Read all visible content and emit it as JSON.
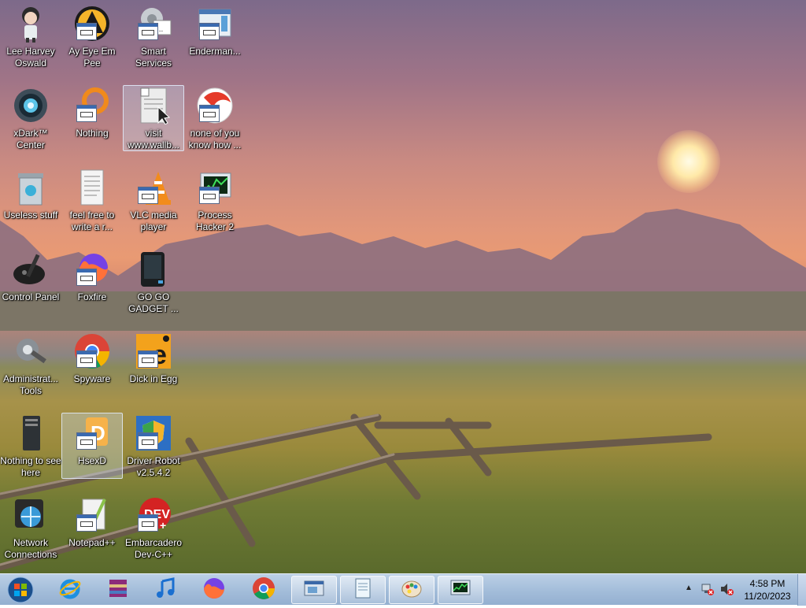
{
  "desktop_icons": [
    {
      "label": "Lee Harvey Oswald",
      "icon": "chibi-character-icon"
    },
    {
      "label": "Ay Eye Em Pee",
      "icon": "aimp-icon"
    },
    {
      "label": "Smart Services",
      "icon": "gear-app-icon"
    },
    {
      "label": "Enderman...",
      "icon": "window-app-icon"
    },
    {
      "label": "xDark™ Center",
      "icon": "xdark-center-icon"
    },
    {
      "label": "Nothing",
      "icon": "orange-ring-icon"
    },
    {
      "label": "visit www.wallb...",
      "icon": "text-document-icon"
    },
    {
      "label": "none of you know how ...",
      "icon": "red-app-icon"
    },
    {
      "label": "Useless stuff",
      "icon": "trash-bin-icon"
    },
    {
      "label": "feel free to write a r...",
      "icon": "text-document-icon"
    },
    {
      "label": "VLC media player",
      "icon": "vlc-icon"
    },
    {
      "label": "Process Hacker 2",
      "icon": "process-hacker-icon"
    },
    {
      "label": "Control Panel",
      "icon": "control-panel-icon"
    },
    {
      "label": "Foxfire",
      "icon": "firefox-icon"
    },
    {
      "label": "GO GO GADGET ...",
      "icon": "black-device-icon"
    },
    {
      "label": "Administrat... Tools",
      "icon": "admin-tools-icon"
    },
    {
      "label": "Spyware",
      "icon": "chrome-icon"
    },
    {
      "label": "Dick in Egg",
      "icon": "orange-e-icon"
    },
    {
      "label": "Nothing to see here",
      "icon": "pc-tower-icon"
    },
    {
      "label": "HsexD",
      "icon": "hsexd-icon"
    },
    {
      "label": "Driver Robot v2.5.4.2",
      "icon": "shield-icon"
    },
    {
      "label": "Network Connections",
      "icon": "network-globe-icon"
    },
    {
      "label": "Notepad++",
      "icon": "notepad-plus-icon"
    },
    {
      "label": "Embarcadero Dev-C++",
      "icon": "dev-cpp-icon"
    }
  ],
  "taskbar": {
    "pinned": [
      "internet-explorer-icon",
      "winrar-icon",
      "music-note-icon",
      "firefox-icon",
      "chrome-icon",
      "window-app-icon",
      "notepad-icon",
      "paint-icon",
      "process-hacker-icon"
    ],
    "time": "4:58 PM",
    "date": "11/20/2023"
  }
}
